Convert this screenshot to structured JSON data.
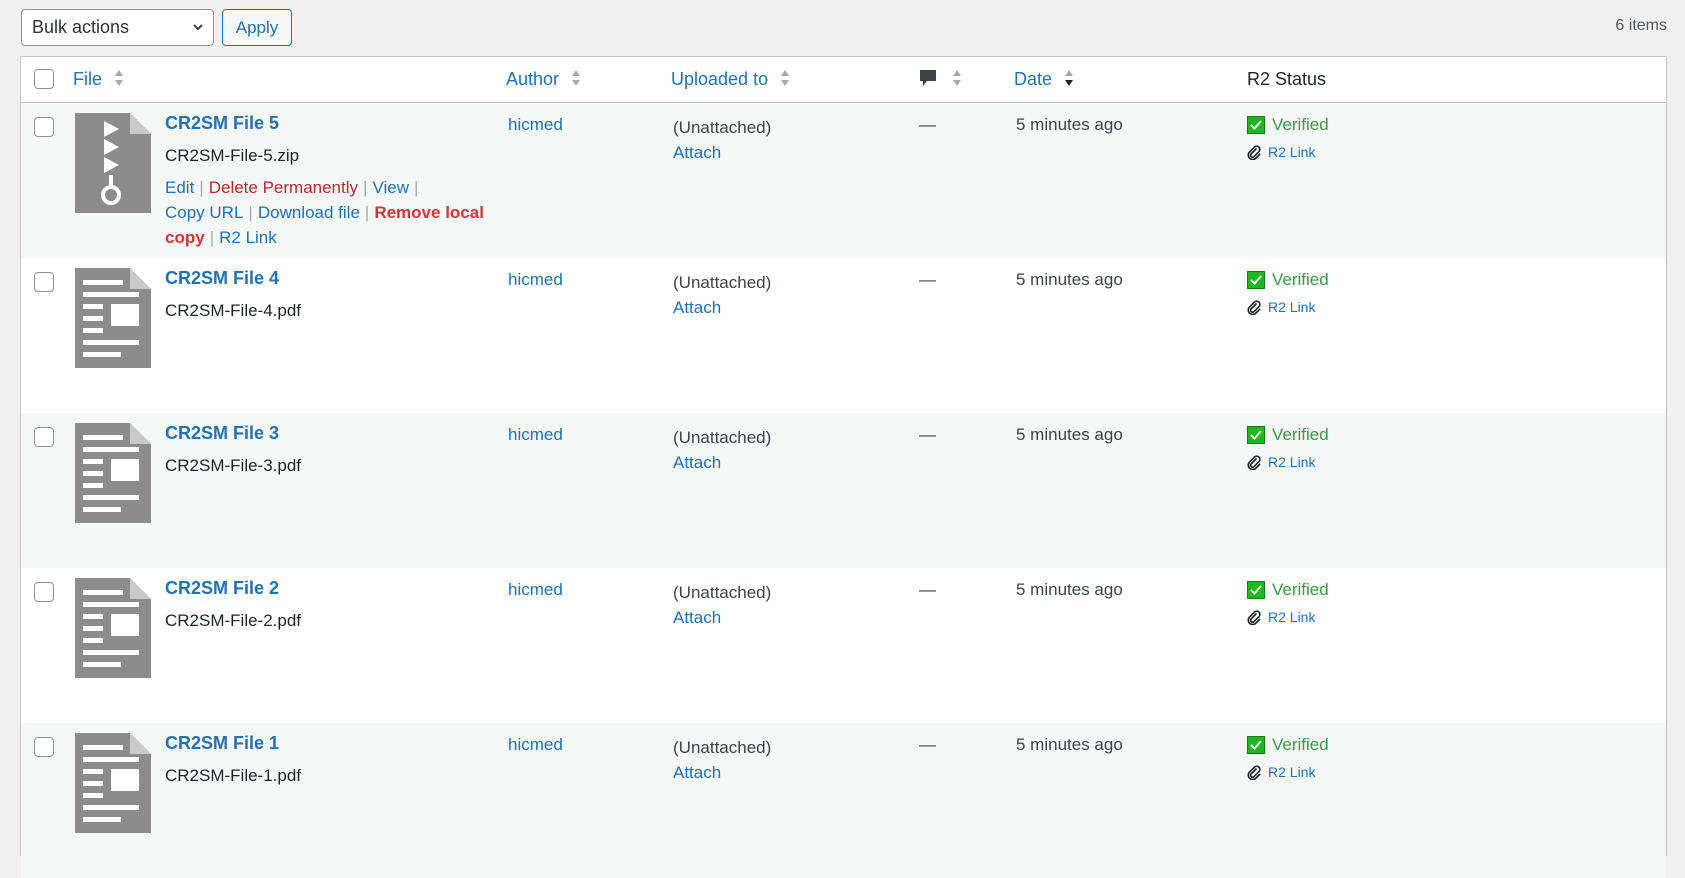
{
  "tablenav": {
    "bulk_actions": "Bulk actions",
    "apply": "Apply",
    "items_count": "6 items"
  },
  "columns": {
    "file": "File",
    "author": "Author",
    "uploaded_to": "Uploaded to",
    "date": "Date",
    "r2_status": "R2 Status"
  },
  "row_actions": {
    "edit": "Edit",
    "delete": "Delete Permanently",
    "view": "View",
    "copy_url": "Copy URL",
    "download": "Download file",
    "remove_local": "Remove local copy",
    "r2_link": "R2 Link"
  },
  "rows": [
    {
      "title": "CR2SM File 5",
      "filename": "CR2SM-File-5.zip",
      "author": "hicmed",
      "uploaded": "(Unattached)",
      "attach": "Attach",
      "comments": "—",
      "date": "5 minutes ago",
      "status": "Verified",
      "r2_link": "R2 Link",
      "icon": "archive"
    },
    {
      "title": "CR2SM File 4",
      "filename": "CR2SM-File-4.pdf",
      "author": "hicmed",
      "uploaded": "(Unattached)",
      "attach": "Attach",
      "comments": "—",
      "date": "5 minutes ago",
      "status": "Verified",
      "r2_link": "R2 Link",
      "icon": "document"
    },
    {
      "title": "CR2SM File 3",
      "filename": "CR2SM-File-3.pdf",
      "author": "hicmed",
      "uploaded": "(Unattached)",
      "attach": "Attach",
      "comments": "—",
      "date": "5 minutes ago",
      "status": "Verified",
      "r2_link": "R2 Link",
      "icon": "document"
    },
    {
      "title": "CR2SM File 2",
      "filename": "CR2SM-File-2.pdf",
      "author": "hicmed",
      "uploaded": "(Unattached)",
      "attach": "Attach",
      "comments": "—",
      "date": "5 minutes ago",
      "status": "Verified",
      "r2_link": "R2 Link",
      "icon": "document"
    },
    {
      "title": "CR2SM File 1",
      "filename": "CR2SM-File-1.pdf",
      "author": "hicmed",
      "uploaded": "(Unattached)",
      "attach": "Attach",
      "comments": "—",
      "date": "5 minutes ago",
      "status": "Verified",
      "r2_link": "R2 Link",
      "icon": "document"
    }
  ],
  "colors": {
    "link": "#2271b1",
    "verified": "#3a9a45",
    "delete": "#b32d2e",
    "icon_gray": "#8c8c8c"
  }
}
